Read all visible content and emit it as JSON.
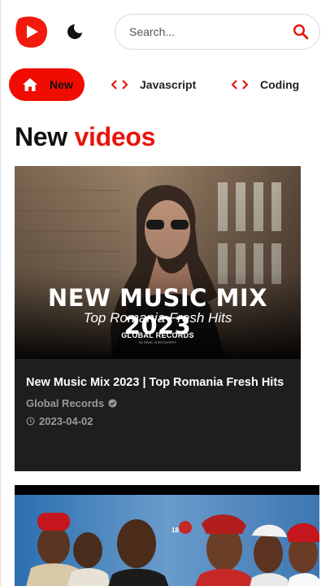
{
  "header": {
    "logo_icon": "youtube-play-logo-icon",
    "theme_icon": "moon-icon",
    "search": {
      "placeholder": "Search...",
      "value": "",
      "icon": "search-icon"
    }
  },
  "tabs": [
    {
      "label": "New",
      "icon": "home-icon",
      "active": true
    },
    {
      "label": "Javascript",
      "icon": "code-icon",
      "active": false
    },
    {
      "label": "Coding",
      "icon": "code-icon",
      "active": false
    }
  ],
  "section": {
    "title_main": "New",
    "title_accent": "videos"
  },
  "videos": [
    {
      "thumbnail": {
        "headline": "NEW MUSIC MIX 2023",
        "subheadline": "Top Romania Fresh Hits",
        "brand": "GLOBAL RECORDS",
        "brand_sub": "GLOBAL DISCOVERY"
      },
      "title": "New Music Mix 2023 | Top Romania Fresh Hits",
      "channel": "Global Records",
      "verified": true,
      "date": "2023-04-02"
    },
    {
      "thumbnail": {
        "badge": "18"
      }
    }
  ],
  "colors": {
    "accent": "#e8150c",
    "card_bg": "#1e1e1e",
    "meta_text": "#9a9a9a"
  }
}
